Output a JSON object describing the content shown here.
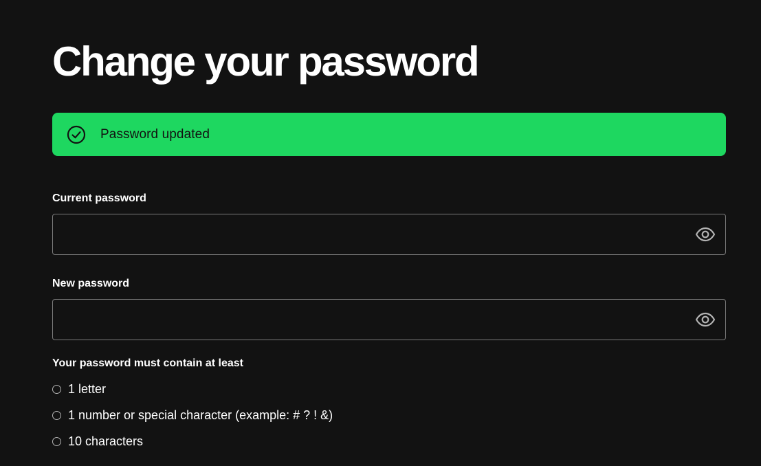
{
  "page": {
    "title": "Change your password"
  },
  "banner": {
    "message": "Password updated",
    "icon": "check-circle-icon",
    "color": "#1ed760"
  },
  "current_password": {
    "label": "Current password",
    "value": "",
    "toggle_icon": "eye-icon"
  },
  "new_password": {
    "label": "New password",
    "value": "",
    "toggle_icon": "eye-icon"
  },
  "requirements": {
    "title": "Your password must contain at least",
    "items": [
      {
        "label": "1 letter"
      },
      {
        "label": "1 number or special character (example: # ? ! &)"
      },
      {
        "label": "10 characters"
      }
    ]
  },
  "colors": {
    "background": "#121212",
    "accent": "#1ed760",
    "field_border": "#7c7c7c"
  }
}
